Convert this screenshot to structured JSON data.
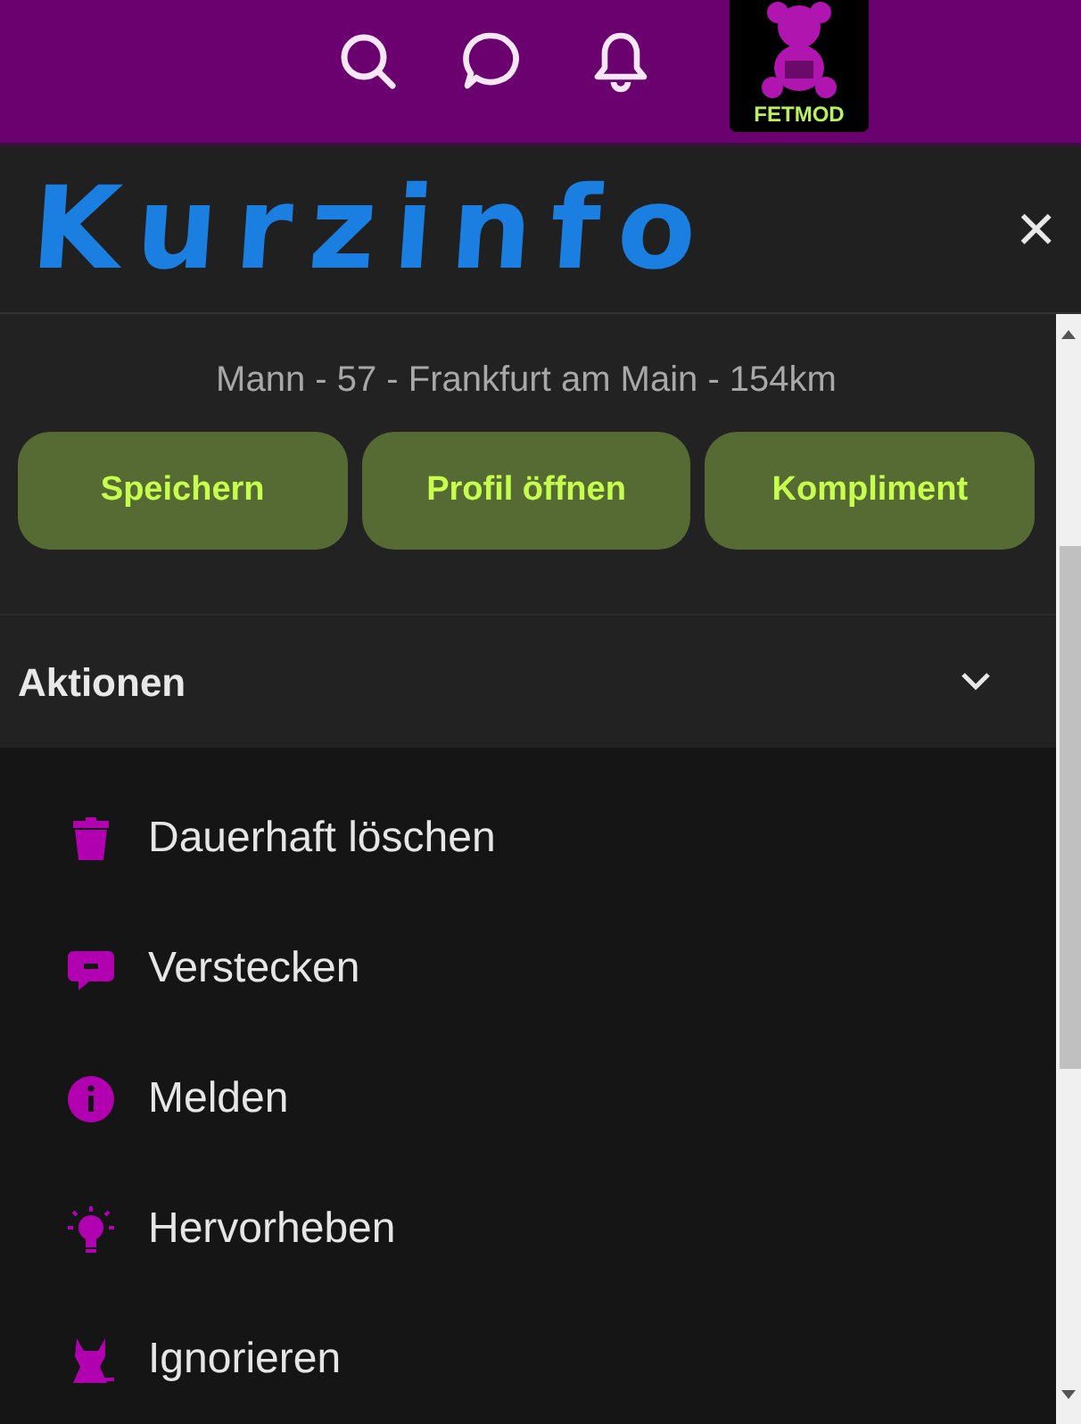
{
  "logo": {
    "text": "FETMOD"
  },
  "dialog": {
    "title": "Kurzinfo",
    "close": "×"
  },
  "profile": {
    "details": "Mann - 57 - Frankfurt am Main - 154km",
    "buttons": [
      "Speichern",
      "Profil öffnen",
      "Kompliment"
    ]
  },
  "actions": {
    "title": "Aktionen",
    "expanded": true,
    "items": [
      {
        "label": "Dauerhaft löschen",
        "kind": "trash"
      },
      {
        "label": "Verstecken",
        "kind": "hide"
      },
      {
        "label": "Melden",
        "kind": "info"
      },
      {
        "label": "Hervorheben",
        "kind": "highlight"
      },
      {
        "label": "Ignorieren",
        "kind": "ignore"
      }
    ]
  }
}
